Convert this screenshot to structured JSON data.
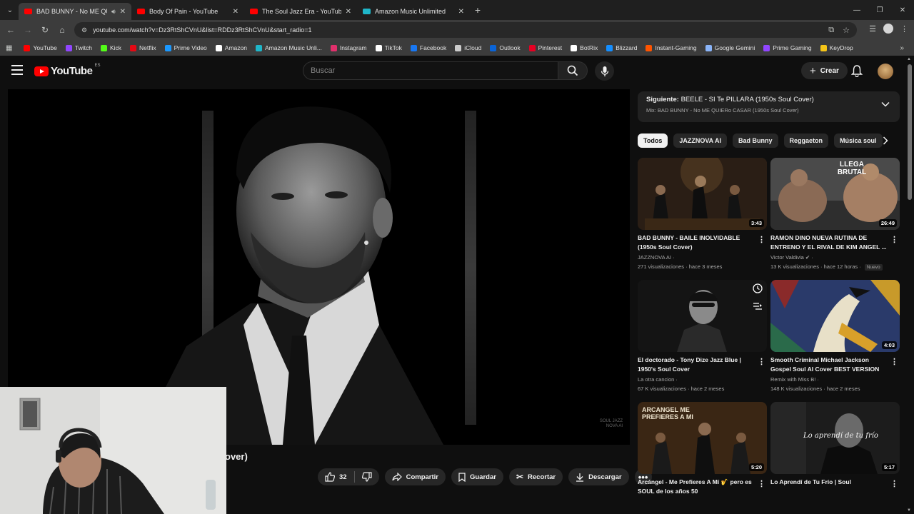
{
  "browser": {
    "tabs": [
      {
        "title": "BAD BUNNY - No ME QUIE",
        "active": true,
        "favicon": "youtube-icon"
      },
      {
        "title": "Body Of Pain - YouTube",
        "active": false,
        "favicon": "youtube-icon"
      },
      {
        "title": "The Soul Jazz Era - YouTube",
        "active": false,
        "favicon": "youtube-icon"
      },
      {
        "title": "Amazon Music Unlimited",
        "active": false,
        "favicon": "amazon-music-icon"
      }
    ],
    "url": "youtube.com/watch?v=Dz3RtShCVnU&list=RDDz3RtShCVnU&start_radio=1",
    "bookmarks": [
      {
        "label": "YouTube",
        "color": "#ff0000"
      },
      {
        "label": "Twitch",
        "color": "#9146ff"
      },
      {
        "label": "Kick",
        "color": "#53fc18"
      },
      {
        "label": "Netflix",
        "color": "#e50914"
      },
      {
        "label": "Prime Video",
        "color": "#1a98ff"
      },
      {
        "label": "Amazon",
        "color": "#ffffff"
      },
      {
        "label": "Amazon Music Unli...",
        "color": "#1fb6c9"
      },
      {
        "label": "Instagram",
        "color": "#e1306c"
      },
      {
        "label": "TikTok",
        "color": "#ffffff"
      },
      {
        "label": "Facebook",
        "color": "#1877f2"
      },
      {
        "label": "iCloud",
        "color": "#cccccc"
      },
      {
        "label": "Outlook",
        "color": "#0a64d8"
      },
      {
        "label": "Pinterest",
        "color": "#e60023"
      },
      {
        "label": "BotRix",
        "color": "#ffffff"
      },
      {
        "label": "Blizzard",
        "color": "#148eff"
      },
      {
        "label": "Instant-Gaming",
        "color": "#ff5400"
      },
      {
        "label": "Google Gemini",
        "color": "#8ab4f8"
      },
      {
        "label": "Prime Gaming",
        "color": "#9146ff"
      },
      {
        "label": "KeyDrop",
        "color": "#f5c518"
      }
    ]
  },
  "header": {
    "logo_text": "YouTube",
    "country_code": "ES",
    "search_placeholder": "Buscar",
    "create_label": "Crear"
  },
  "video": {
    "title_fragment": "over)",
    "watermark_line1": "SOUL JAZZ",
    "watermark_line2": "NOVA AI",
    "likes": "32",
    "share_label": "Compartir",
    "save_label": "Guardar",
    "clip_label": "Recortar",
    "download_label": "Descargar"
  },
  "sidebar": {
    "next_prefix": "Siguiente:",
    "next_title": "BEELE - SI Te PILLARA (1950s Soul Cover)",
    "mix_label": "Mix: BAD BUNNY - No ME QUIERo CASAR (1950s Soul Cover)",
    "chips": [
      "Todos",
      "JAZZNOVA AI",
      "Bad Bunny",
      "Reggaeton",
      "Música soul"
    ],
    "videos": [
      {
        "title": "BAD BUNNY - BAILE INOLVIDABLE (1950s Soul Cover)",
        "channel": "JAZZNOVA AI",
        "views": "271 visualizaciones",
        "age": "hace 3 meses",
        "duration": "3:43",
        "badge": ""
      },
      {
        "title": "RAMON DINO NUEVA RUTINA DE ENTRENO Y EL RIVAL DE KIM ANGEL ...",
        "channel": "Victor Valdivia",
        "views": "13 K visualizaciones",
        "age": "hace 12 horas",
        "duration": "26:49",
        "badge": "Nuevo",
        "thumb_text": "LLEGA BRUTAL"
      },
      {
        "title": "El doctorado - Tony Dize Jazz Blue | 1950's Soul Cover",
        "channel": "La otra cancion",
        "views": "67 K visualizaciones",
        "age": "hace 2 meses",
        "duration": "",
        "badge": ""
      },
      {
        "title": "Smooth Criminal  Michael Jackson Gospel Soul AI Cover BEST VERSION",
        "channel": "Remix with Miss B!",
        "views": "148 K visualizaciones",
        "age": "hace 2 meses",
        "duration": "4:03",
        "badge": ""
      },
      {
        "title": "Arcángel - Me Prefieres A Mí 🎷 pero es SOUL de los años 50",
        "channel": "",
        "views": "",
        "age": "",
        "duration": "5:20",
        "badge": "",
        "thumb_text": "ARCANGEL ME PREFIERES A MI"
      },
      {
        "title": "Lo Aprendí de Tu Frío | Soul",
        "channel": "",
        "views": "",
        "age": "",
        "duration": "5:17",
        "badge": "",
        "thumb_text": "Lo aprendí de tu frío"
      }
    ]
  },
  "colors": {
    "background": "#0f0f0f",
    "surface": "#272727",
    "youtube_red": "#ff0000",
    "muted_text": "#aaaaaa"
  }
}
